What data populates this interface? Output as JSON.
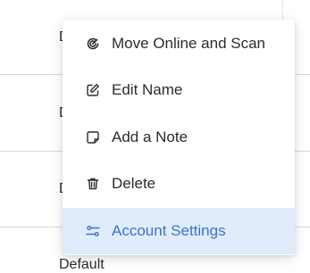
{
  "background_rows": [
    {
      "text": "D"
    },
    {
      "text": "D"
    },
    {
      "text": "D"
    },
    {
      "text": "Default"
    }
  ],
  "menu": {
    "items": [
      {
        "label": "Move Online and Scan",
        "icon": "sync-scan-icon",
        "active": false
      },
      {
        "label": "Edit Name",
        "icon": "edit-icon",
        "active": false
      },
      {
        "label": "Add a Note",
        "icon": "note-icon",
        "active": false
      },
      {
        "label": "Delete",
        "icon": "trash-icon",
        "active": false
      },
      {
        "label": "Account Settings",
        "icon": "settings-sliders-icon",
        "active": true
      }
    ]
  },
  "colors": {
    "active_bg": "#e1ecfa",
    "active_text": "#3a73c9",
    "text": "#2b2b2b"
  }
}
